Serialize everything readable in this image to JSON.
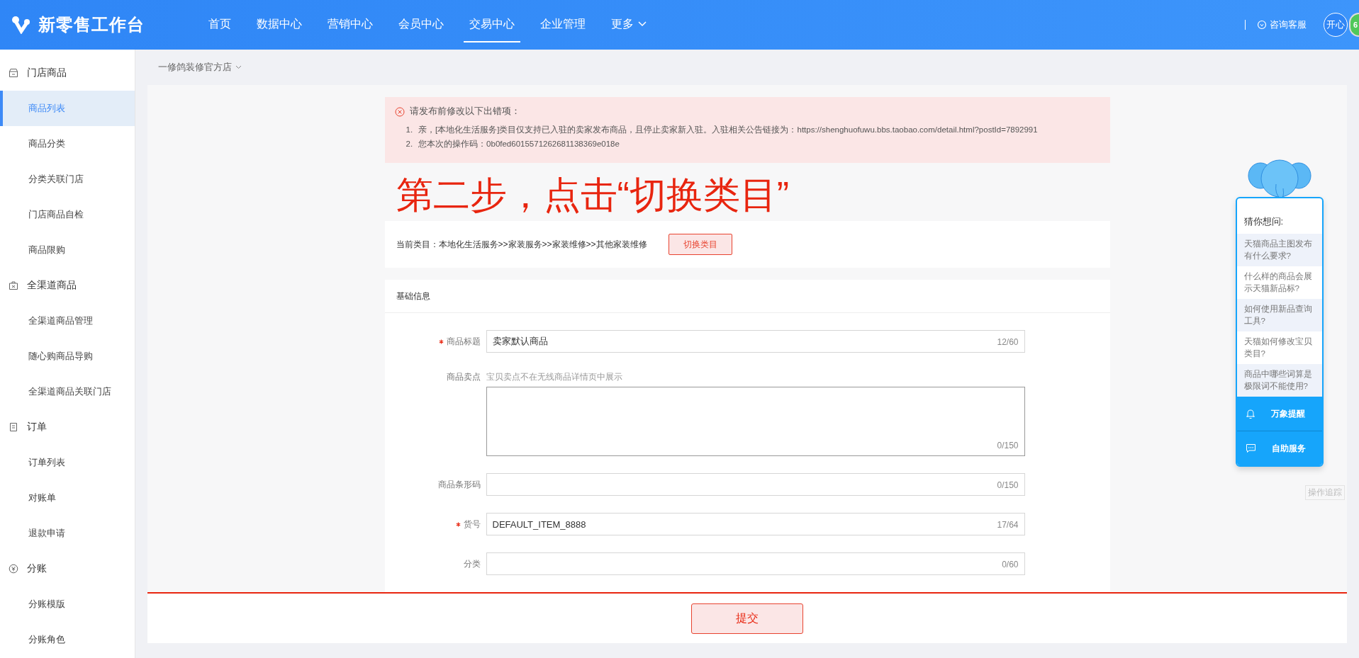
{
  "header": {
    "logo": "新零售工作台",
    "nav": [
      {
        "label": "首页",
        "selected": false
      },
      {
        "label": "数据中心",
        "selected": false
      },
      {
        "label": "营销中心",
        "selected": false
      },
      {
        "label": "会员中心",
        "selected": false
      },
      {
        "label": "交易中心",
        "selected": true
      },
      {
        "label": "企业管理",
        "selected": false
      }
    ],
    "more": "更多",
    "support": "咨询客服",
    "avatar": "开心",
    "badge": "6"
  },
  "sidebar": {
    "groups": [
      {
        "label": "门店商品",
        "children": [
          {
            "label": "商品列表",
            "selected": true
          },
          {
            "label": "商品分类",
            "selected": false
          },
          {
            "label": "分类关联门店",
            "selected": false
          },
          {
            "label": "门店商品自检",
            "selected": false
          },
          {
            "label": "商品限购",
            "selected": false
          }
        ]
      },
      {
        "label": "全渠道商品",
        "children": [
          {
            "label": "全渠道商品管理",
            "selected": false
          },
          {
            "label": "随心购商品导购",
            "selected": false
          },
          {
            "label": "全渠道商品关联门店",
            "selected": false
          }
        ]
      },
      {
        "label": "订单",
        "children": [
          {
            "label": "订单列表",
            "selected": false
          },
          {
            "label": "对账单",
            "selected": false
          },
          {
            "label": "退款申请",
            "selected": false
          }
        ]
      },
      {
        "label": "分账",
        "children": [
          {
            "label": "分账模版",
            "selected": false
          },
          {
            "label": "分账角色",
            "selected": false
          }
        ]
      }
    ]
  },
  "store_selector": "一修鸽装修官方店",
  "error": {
    "title": "请发布前修改以下出错项：",
    "items": [
      {
        "number": "1.",
        "text": "亲，[本地化生活服务]类目仅支持已入驻的卖家发布商品，且停止卖家新入驻。入驻相关公告链接为：https://shenghuofuwu.bbs.taobao.com/detail.html?postId=7892991"
      },
      {
        "number": "2.",
        "text": "您本次的操作码：0b0fed6015571262681138369e018e"
      }
    ]
  },
  "annotation": "第二步，点击“切换类目”",
  "category": {
    "label": "当前类目：本地化生活服务>>家装服务>>家装维修>>其他家装维修",
    "button": "切换类目"
  },
  "basic_info": {
    "title": "基础信息",
    "fields": [
      {
        "label": "商品标题",
        "required": true,
        "kind": "input",
        "value": "卖家默认商品",
        "counter": "12/60"
      },
      {
        "label": "商品卖点",
        "required": false,
        "kind": "textarea",
        "note": "宝贝卖点不在无线商品详情页中展示",
        "counter": "0/150"
      },
      {
        "label": "商品条形码",
        "required": false,
        "kind": "input",
        "counter": "0/150"
      },
      {
        "label": "货号",
        "required": true,
        "kind": "input",
        "value": "DEFAULT_ITEM_8888",
        "counter": "17/64"
      },
      {
        "label": "分类",
        "required": false,
        "kind": "input",
        "counter": "0/60"
      }
    ]
  },
  "submit": "提交",
  "helper": {
    "title": "猜你想问:",
    "questions": [
      "天猫商品主图发布有什么要求?",
      "什么样的商品会展示天猫新品标?",
      "如何使用新品查询工具?",
      "天猫如何修改宝贝类目?",
      "商品中哪些词算是极限词不能使用?"
    ],
    "actions": [
      {
        "kind": "bell",
        "label": "万象提醒"
      },
      {
        "kind": "chat",
        "label": "自助服务"
      }
    ],
    "trace": "操作追踪"
  }
}
